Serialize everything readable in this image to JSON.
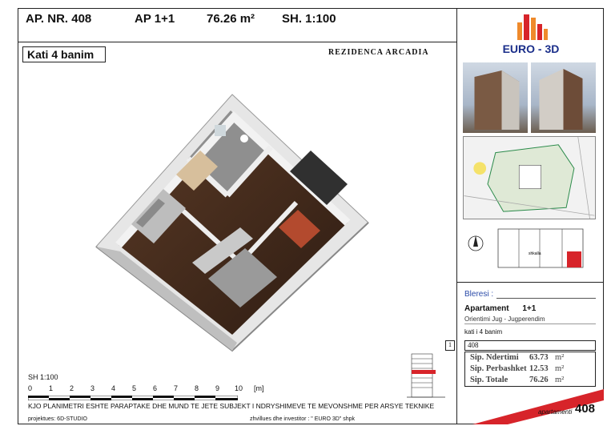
{
  "header": {
    "apartment_no": "AP. NR. 408",
    "type": "AP 1+1",
    "area": "76.26 m²",
    "scale": "SH. 1:100"
  },
  "floor_label": "Kati 4 banim",
  "project_name": "REZIDENCA ARCADIA",
  "brand": {
    "name": "EURO - 3D",
    "accent": "#d7242a",
    "secondary": "#ef8a2b"
  },
  "scale_bar": {
    "title": "SH 1:100",
    "ticks": [
      "0",
      "1",
      "2",
      "3",
      "4",
      "5",
      "6",
      "7",
      "8",
      "9",
      "10"
    ],
    "unit": "[m]"
  },
  "notice": "KJO PLANIMETRI ESHTE PARAPTAKE DHE MUND TE JETE SUBJEKT I NDRYSHIMEVE TE MEVONSHME PER ARSYE TEKNIKE",
  "footer": {
    "designer": "projektues:  6D-STUDIO",
    "developer": "zhvillues dhe investitor :  \" EURO 3D\" shpk"
  },
  "info": {
    "buyer_label": "Bleresi :",
    "apartment_label": "Apartament",
    "apartment_type": "1+1",
    "orientation": "Orientimi  Jug - Jugperendim",
    "floor": "kati i 4 banim",
    "index": "1",
    "apartment_number": "408",
    "areas": [
      {
        "label": "Sip. Ndertimi",
        "value": "63.73",
        "unit": "m²"
      },
      {
        "label": "Sip. Perbashket",
        "value": "12.53",
        "unit": "m²"
      },
      {
        "label": "Sip. Totale",
        "value": "76.26",
        "unit": "m²"
      }
    ]
  },
  "badge": {
    "label": "apartamenti",
    "number": "408"
  },
  "keyplan_label": "shkalla"
}
